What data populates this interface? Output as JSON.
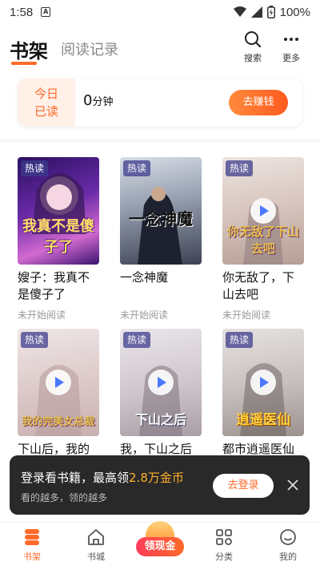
{
  "status_bar": {
    "time": "1:58",
    "notif_glyph": "A",
    "battery": "100%"
  },
  "header": {
    "tab_bookshelf": "书架",
    "tab_history": "阅读记录",
    "search_label": "搜索",
    "more_label": "更多"
  },
  "reading": {
    "today_label_1": "今日",
    "today_label_2": "已读",
    "minutes_value": "0",
    "minutes_unit": "分钟",
    "earn_button": "去赚钱"
  },
  "books": [
    {
      "title": "嫂子：我真不是傻子了",
      "status": "未开始阅读",
      "badge": "热读",
      "cover_text": "我真不是傻子了",
      "has_video": false
    },
    {
      "title": "一念神魔",
      "status": "未开始阅读",
      "badge": "热读",
      "cover_text": "一念神魔",
      "has_video": false
    },
    {
      "title": "你无敌了，下山去吧",
      "status": "未开始阅读",
      "badge": "热读",
      "cover_text": "你无敌了下山去吧",
      "has_video": true
    },
    {
      "title": "下山后，我的",
      "status": "",
      "badge": "热读",
      "cover_text": "我的完美女总裁",
      "has_video": true
    },
    {
      "title": "我，下山之后",
      "status": "",
      "badge": "热读",
      "cover_text": "下山之后",
      "has_video": true
    },
    {
      "title": "都市逍遥医仙",
      "status": "",
      "badge": "热读",
      "cover_text": "逍遥医仙",
      "has_video": true
    }
  ],
  "toast": {
    "text_prefix": "登录看书籍，最高领",
    "highlight": "2.8万金币",
    "subtext": "看的越多，领的越多",
    "login_button": "去登录"
  },
  "bottom_nav": {
    "bookshelf": "书架",
    "bookstore": "书城",
    "cash": "领现金",
    "category": "分类",
    "mine": "我的"
  },
  "colors": {
    "accent": "#ff6a2a",
    "toast_highlight": "#ffb32a"
  }
}
